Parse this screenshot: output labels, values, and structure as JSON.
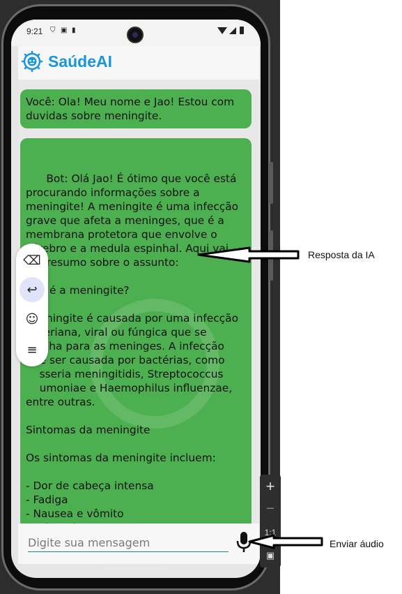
{
  "status_bar": {
    "time": "9:21"
  },
  "app": {
    "title": "SaúdeAI"
  },
  "messages": [
    {
      "sender": "user",
      "text": "Você: Ola! Meu nome e Jao! Estou com duvidas sobre meningite."
    },
    {
      "sender": "bot",
      "text": "Bot: Olá Jao! É ótimo que você está procurando informações sobre a meningite! A meningite é uma infecção grave que afeta a meninges, que é a membrana protetora que envolve o cérebro e a medula espinhal. Aqui vai um resumo sobre o assunto:\n\n    e é a meningite?\n\n    eningite é causada por uma infecção\n    teriana, viral ou fúngica que se\n    alha para as meninges. A infecção\n    e ser causada por bactérias, como\n    sseria meningitidis, Streptococcus\n    umoniae e Haemophilus influenzae,\nentre outras.\n\nSintomas da meningite\n\nOs sintomas da meningite incluem:\n\n- Dor de cabeça intensa\n- Fadiga\n- Nausea e vômito\n- Febre alta\n- Mialgia (dor nos músculos)"
    }
  ],
  "floating_toolbar": {
    "items": [
      {
        "icon": "backspace-icon",
        "glyph": "⌫"
      },
      {
        "icon": "return-icon",
        "glyph": "↩"
      },
      {
        "icon": "emoji-icon",
        "glyph": "☺"
      },
      {
        "icon": "menu-icon",
        "glyph": "≡"
      }
    ]
  },
  "input": {
    "placeholder": "Digite sua mensagem",
    "value": ""
  },
  "emulator_controls": {
    "zoom_in": "+",
    "zoom_out": "−",
    "ratio": "1:1"
  },
  "annotations": {
    "response_label": "Resposta da IA",
    "audio_label": "Enviar áudio"
  },
  "colors": {
    "accent": "#1a96d8",
    "bubble": "#4caf50",
    "input_underline": "#1f7f80"
  }
}
